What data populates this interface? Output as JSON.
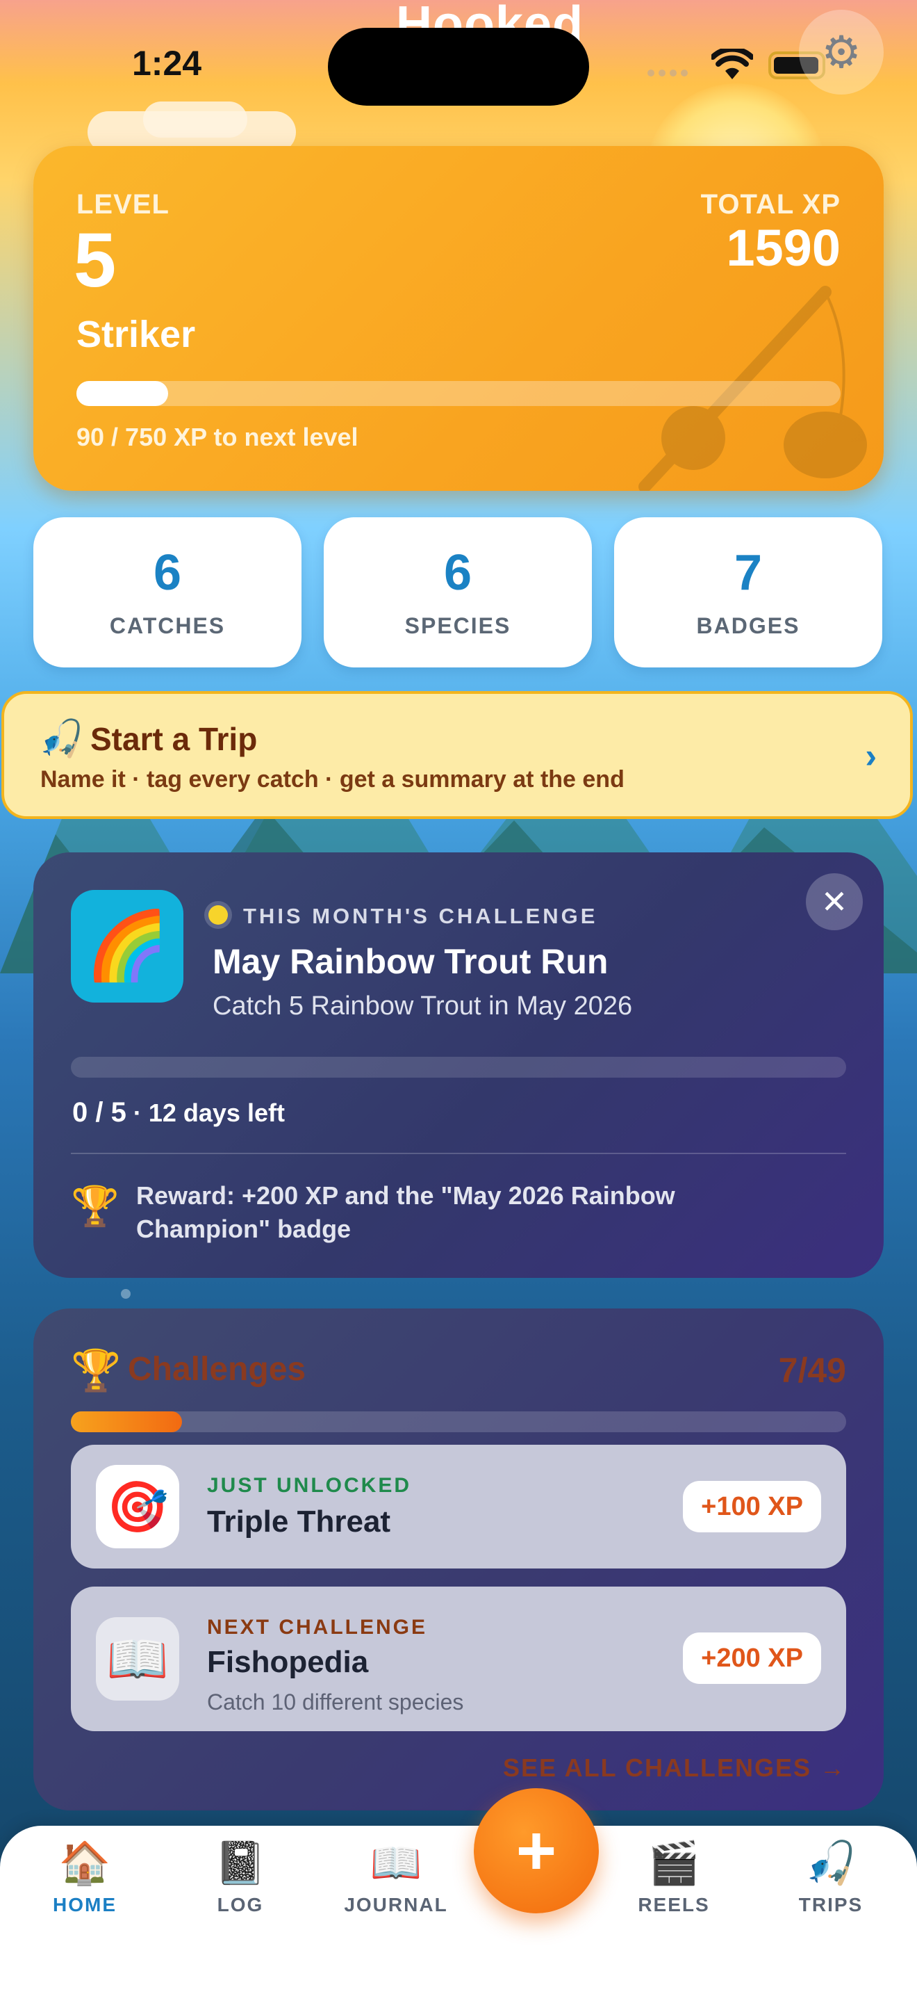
{
  "app": {
    "title": "Hooked"
  },
  "status_bar": {
    "time": "1:24"
  },
  "level_card": {
    "level_label": "LEVEL",
    "level_value": "5",
    "rank_title": "Striker",
    "total_xp_label": "TOTAL XP",
    "total_xp_value": "1590",
    "progress_text": "90 / 750 XP to next level",
    "progress_fraction": 0.12
  },
  "stats": [
    {
      "value": "6",
      "label": "CATCHES"
    },
    {
      "value": "6",
      "label": "SPECIES"
    },
    {
      "value": "7",
      "label": "BADGES"
    }
  ],
  "trip_banner": {
    "icon": "🎣",
    "title": "Start a Trip",
    "subtitle": "Name it · tag every catch · get a summary at the end",
    "chevron": "›"
  },
  "monthly_challenge": {
    "icon": "🌈",
    "tag": "THIS MONTH'S CHALLENGE",
    "title": "May Rainbow Trout Run",
    "description": "Catch 5 Rainbow Trout in May 2026",
    "progress_count": "0 / 5",
    "progress_suffix": "· 12 days left",
    "progress_fraction": 0,
    "reward_icon": "🏆",
    "reward_text": "Reward: +200 XP and the \"May 2026 Rainbow Champion\" badge",
    "close_glyph": "✕"
  },
  "challenges": {
    "icon": "🏆",
    "title": "Challenges",
    "count": "7/49",
    "progress_fraction": 0.143,
    "items": [
      {
        "icon": "🎯",
        "kicker": "JUST UNLOCKED",
        "kicker_color": "#1f8a4c",
        "name": "Triple Threat",
        "desc": "",
        "xp": "+100 XP"
      },
      {
        "icon": "📖",
        "kicker": "NEXT CHALLENGE",
        "kicker_color": "#8a3a12",
        "name": "Fishopedia",
        "desc": "Catch 10 different species",
        "xp": "+200 XP"
      }
    ],
    "see_all": "SEE ALL CHALLENGES →"
  },
  "tabs": [
    {
      "icon": "🏠",
      "label": "HOME",
      "active": true
    },
    {
      "icon": "📓",
      "label": "LOG",
      "active": false
    },
    {
      "icon": "📖",
      "label": "JOURNAL",
      "active": false
    },
    {
      "icon": "🎬",
      "label": "REELS",
      "active": false
    },
    {
      "icon": "🎣",
      "label": "TRIPS",
      "active": false
    }
  ],
  "fab": {
    "glyph": "+"
  },
  "colors": {
    "accent": "#1b82c4",
    "orange": "#f26a12",
    "gold": "#f9a420"
  }
}
